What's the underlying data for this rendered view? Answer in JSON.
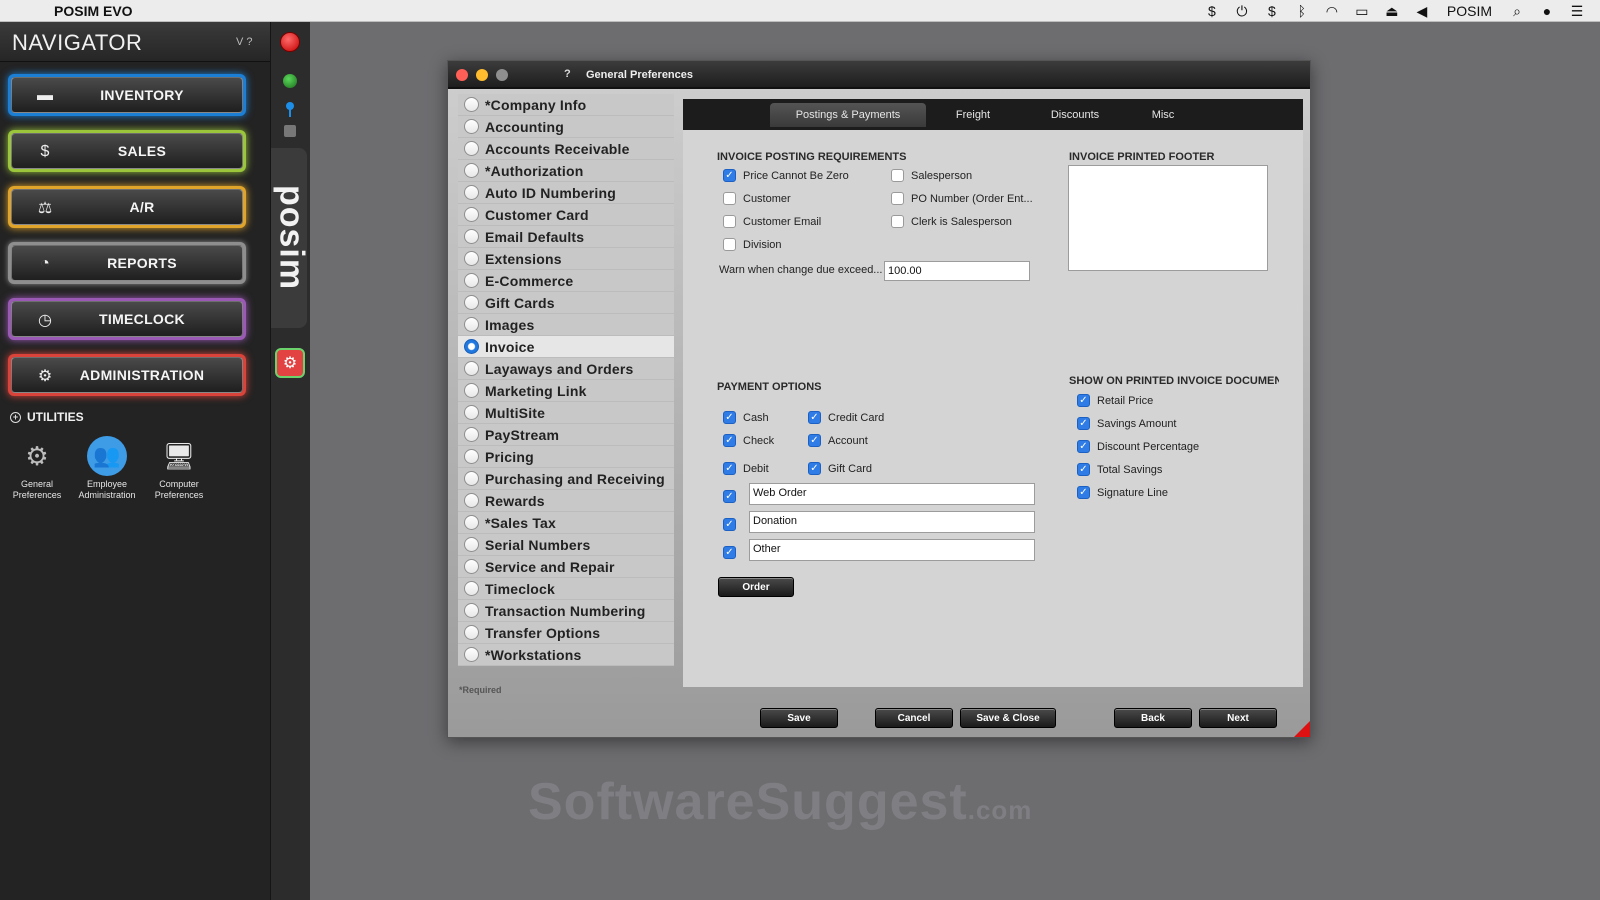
{
  "menubar": {
    "app_name": "POSIM EVO",
    "user": "POSIM"
  },
  "navigator": {
    "title": "NAVIGATOR",
    "v_label": "V",
    "q_label": "?",
    "buttons": [
      {
        "label": "INVENTORY",
        "color": "#1c7fd6"
      },
      {
        "label": "SALES",
        "color": "#9bc53a"
      },
      {
        "label": "A/R",
        "color": "#e0a42a"
      },
      {
        "label": "REPORTS",
        "color": "#8e8e8e"
      },
      {
        "label": "TIMECLOCK",
        "color": "#9b59b6"
      },
      {
        "label": "ADMINISTRATION",
        "color": "#d9433a"
      }
    ],
    "utilities": {
      "header": "UTILITIES",
      "items": [
        {
          "label_line1": "General",
          "label_line2": "Preferences"
        },
        {
          "label_line1": "Employee",
          "label_line2": "Administration"
        },
        {
          "label_line1": "Computer",
          "label_line2": "Preferences"
        }
      ]
    },
    "brand": "posim"
  },
  "window": {
    "title": "General Preferences",
    "help": "?",
    "required_note": "*Required",
    "pref_items": [
      "*Company Info",
      "Accounting",
      "Accounts Receivable",
      "*Authorization",
      "Auto ID Numbering",
      "Customer Card",
      "Email Defaults",
      "Extensions",
      "E-Commerce",
      "Gift Cards",
      "Images",
      "Invoice",
      "Layaways and Orders",
      "Marketing Link",
      "MultiSite",
      "PayStream",
      "Pricing",
      "Purchasing and Receiving",
      "Rewards",
      "*Sales Tax",
      "Serial Numbers",
      "Service and Repair",
      "Timeclock",
      "Transaction Numbering",
      "Transfer Options",
      "*Workstations"
    ],
    "selected_pref": "Invoice",
    "tabs": [
      "Postings & Payments",
      "Freight",
      "Discounts",
      "Misc"
    ],
    "active_tab": "Postings & Payments",
    "posting": {
      "title": "INVOICE POSTING REQUIREMENTS",
      "price_nonzero": "Price Cannot Be Zero",
      "customer": "Customer",
      "customer_email": "Customer Email",
      "division": "Division",
      "salesperson": "Salesperson",
      "po_number": "PO Number (Order Ent...",
      "clerk": "Clerk is Salesperson",
      "warn_label": "Warn when change due exceed...",
      "warn_value": "100.00"
    },
    "footer_title": "INVOICE PRINTED FOOTER",
    "payment": {
      "title": "PAYMENT OPTIONS",
      "cash": "Cash",
      "check": "Check",
      "debit": "Debit",
      "credit_card": "Credit Card",
      "account": "Account",
      "gift_card": "Gift Card",
      "custom1": "Web Order",
      "custom2": "Donation",
      "custom3": "Other",
      "order_button": "Order"
    },
    "show_on_printed": {
      "title": "SHOW ON PRINTED INVOICE DOCUMEN",
      "retail_price": "Retail Price",
      "savings_amount": "Savings Amount",
      "discount_percentage": "Discount Percentage",
      "total_savings": "Total Savings",
      "signature_line": "Signature Line"
    },
    "buttons": {
      "save": "Save",
      "cancel": "Cancel",
      "save_close": "Save & Close",
      "back": "Back",
      "next": "Next"
    }
  },
  "watermark": {
    "main": "SoftwareSuggest",
    "suffix": ".com"
  }
}
